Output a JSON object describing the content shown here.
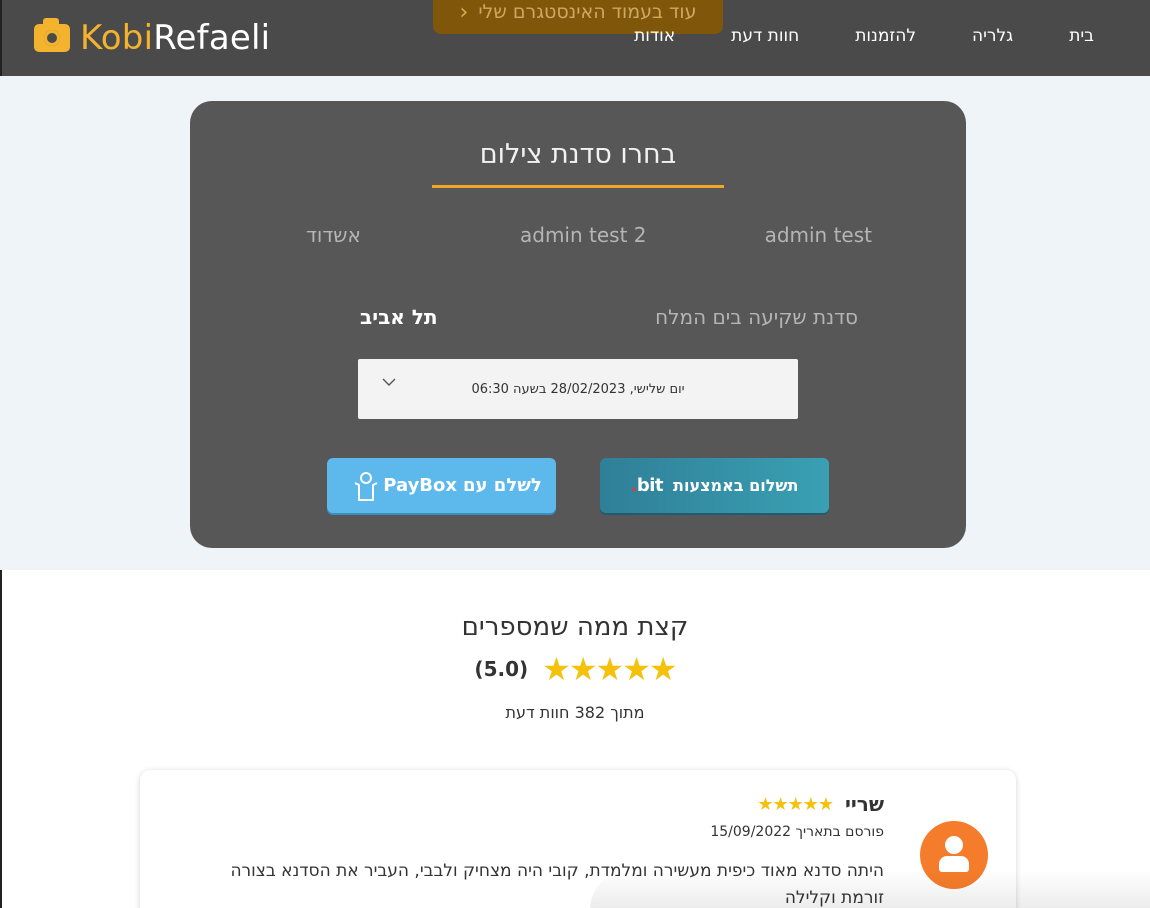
{
  "header": {
    "brand_part1": "Kobi",
    "brand_part2": "Refaeli",
    "instagram_label": "עוד בעמוד האינסטגרם שלי",
    "nav": [
      "בית",
      "גלריה",
      "להזמנות",
      "חוות דעת",
      "אודות"
    ]
  },
  "booking": {
    "title": "בחרו סדנת צילום",
    "options": [
      "admin test",
      "admin test 2",
      "אשדוד",
      "סדנת שקיעה בים המלח",
      "תל אביב"
    ],
    "selected_option": "תל אביב",
    "date_value": "יום שלישי, 28/02/2023 בשעה 06:30",
    "paybox_label": "לשלם עם",
    "paybox_brand": "PayBox",
    "bit_label": "תשלום באמצעות",
    "bit_logo": "bit"
  },
  "reviews": {
    "title": "קצת ממה שמספרים",
    "rating": "(5.0)",
    "stars": "★★★★★",
    "count_text": "מתוך 382 חוות דעת",
    "items": [
      {
        "name": "שריי",
        "stars": "★★★★★",
        "posted": "פורסם בתאריך 15/09/2022",
        "text": "היתה סדנא מאוד כיפית מעשירה ומלמדת, קובי היה מצחיק ולבבי, העביר את הסדנא בצורה זורמת וקלילה"
      }
    ]
  },
  "colors": {
    "header_bg": "#4a4a4a",
    "accent": "#f3a625",
    "panel_bg": "#575757",
    "paybox": "#5db8ec",
    "bit": "#2f7f98",
    "star": "#f4c20d",
    "avatar": "#f47c2a"
  }
}
